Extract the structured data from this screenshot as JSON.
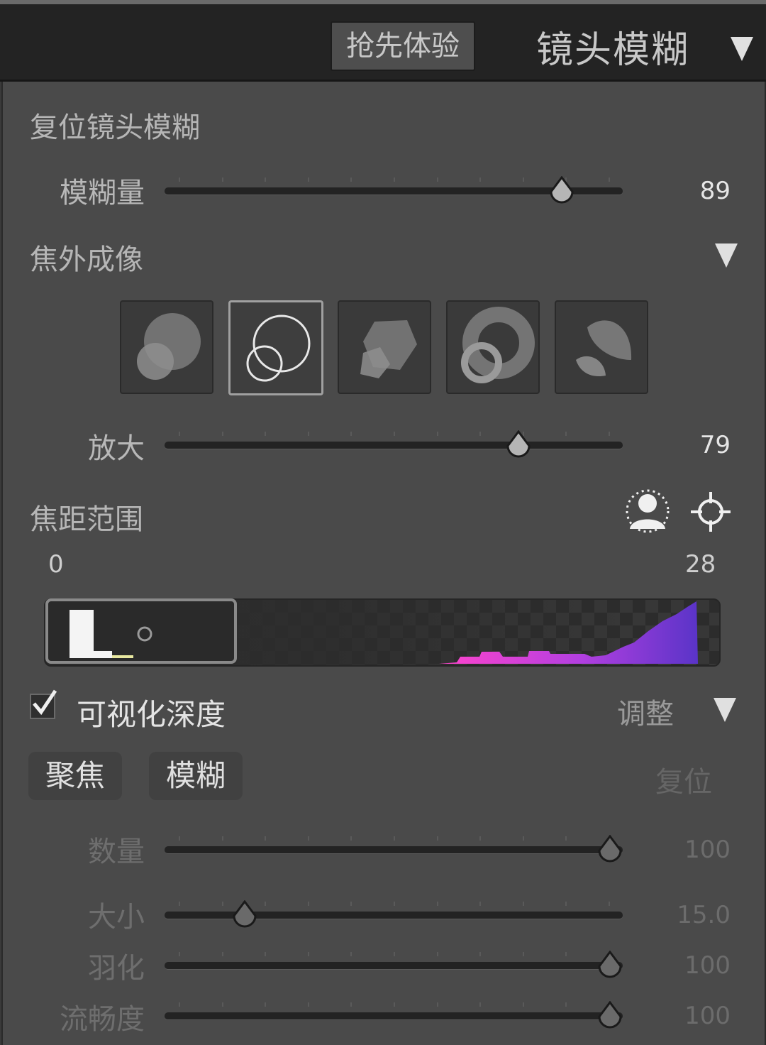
{
  "header": {
    "early_access_label": "抢先体验",
    "panel_title": "镜头模糊"
  },
  "panel": {
    "reset_label": "复位镜头模糊",
    "blur_amount": {
      "label": "模糊量",
      "value": "89",
      "level": 89
    },
    "bokeh": {
      "label": "焦外成像",
      "shapes": [
        "circle",
        "bubble",
        "blade",
        "ring",
        "cat-eye"
      ],
      "selected_index": 1
    },
    "zoom": {
      "label": "放大",
      "value": "79",
      "level": 79
    },
    "focal_range": {
      "label": "焦距范围",
      "min_label": "0",
      "max_label": "28",
      "icons": [
        "subject-select-icon",
        "point-select-icon"
      ]
    },
    "visualize_depth": {
      "label": "可视化深度",
      "checked": true
    },
    "adjust": {
      "label": "调整"
    },
    "refine": {
      "tabs": [
        "聚焦",
        "模糊"
      ],
      "reset_label": "复位",
      "sliders": [
        {
          "label": "数量",
          "value": "100",
          "level": 100
        },
        {
          "label": "大小",
          "value": "15.0",
          "level": 15
        },
        {
          "label": "羽化",
          "value": "100",
          "level": 100
        },
        {
          "label": "流畅度",
          "value": "100",
          "level": 100
        }
      ]
    }
  },
  "colors": {
    "accent_depth_pink": "#ff44cc",
    "accent_depth_purple": "#6a3bd0"
  }
}
